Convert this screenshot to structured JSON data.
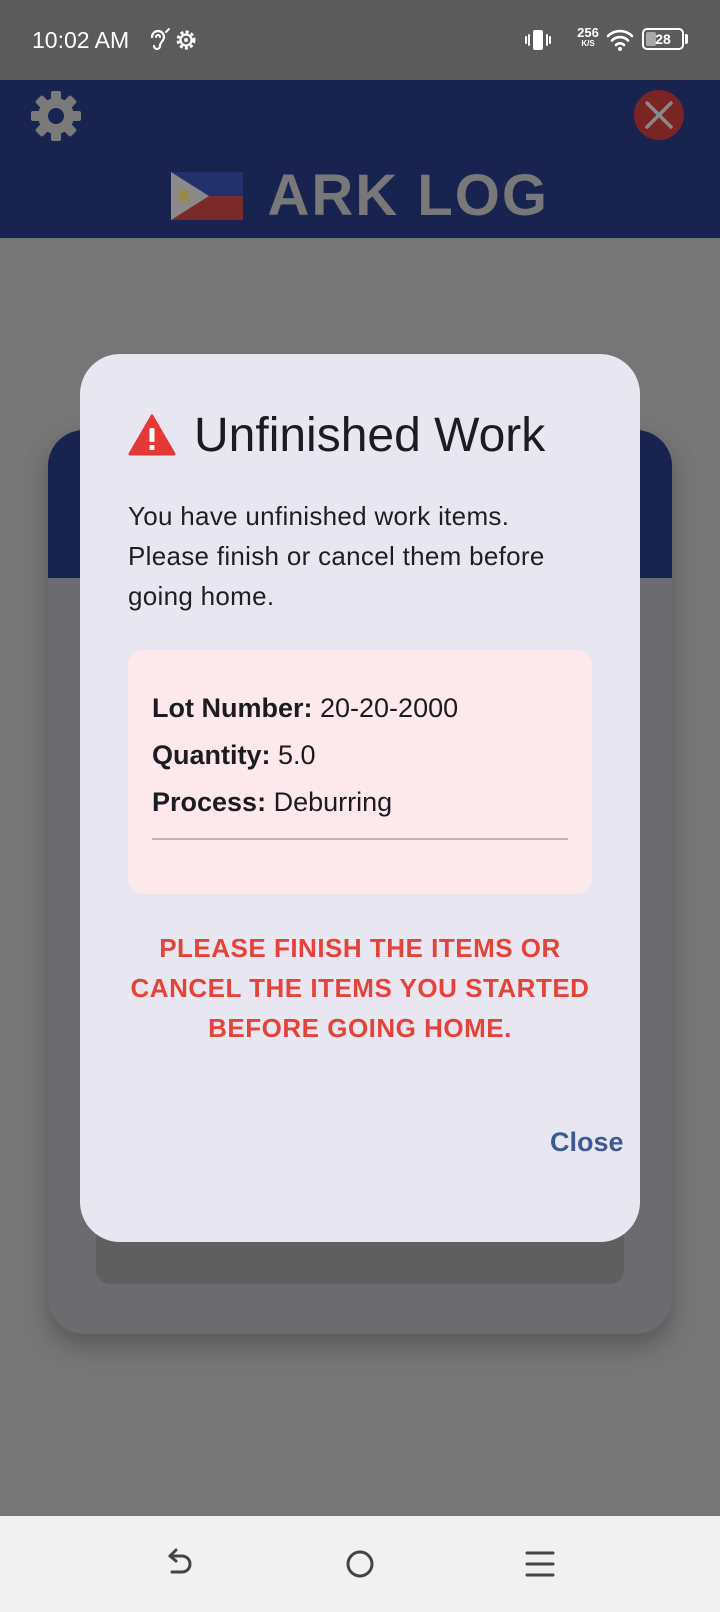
{
  "status_bar": {
    "time": "10:02 AM",
    "net_speed_value": "256",
    "net_speed_unit": "K/S",
    "battery": "28",
    "battery_level": 0.28,
    "icons": [
      "hearing-icon",
      "settings-cog-icon",
      "vibrate-icon",
      "wifi-icon",
      "battery-icon"
    ]
  },
  "header": {
    "title": "ARK LOG",
    "settings_icon": "gear-icon",
    "close_icon": "close-icon",
    "flag_icon": "philippines-flag-icon"
  },
  "dialog": {
    "title": "Unfinished Work",
    "title_icon": "warning-icon",
    "message": "You have unfinished work items. Please finish or cancel them before going home.",
    "item": {
      "lot_label": "Lot Number:",
      "lot_value": "20-20-2000",
      "quantity_label": "Quantity:",
      "quantity_value": "5.0",
      "process_label": "Process:",
      "process_value": "Deburring"
    },
    "warning": "PLEASE FINISH THE ITEMS OR CANCEL THE ITEMS YOU STARTED BEFORE GOING HOME.",
    "close_label": "Close"
  },
  "nav_bar": {
    "icons": [
      "back-icon",
      "home-icon",
      "menu-icon"
    ]
  },
  "colors": {
    "header_bg": "#18244f",
    "dialog_bg": "#e8e7f1",
    "info_box_bg": "#fde9ec",
    "warning_text": "#e2443a",
    "close_button_text": "#3e5a92",
    "warning_icon": "#e53935"
  }
}
